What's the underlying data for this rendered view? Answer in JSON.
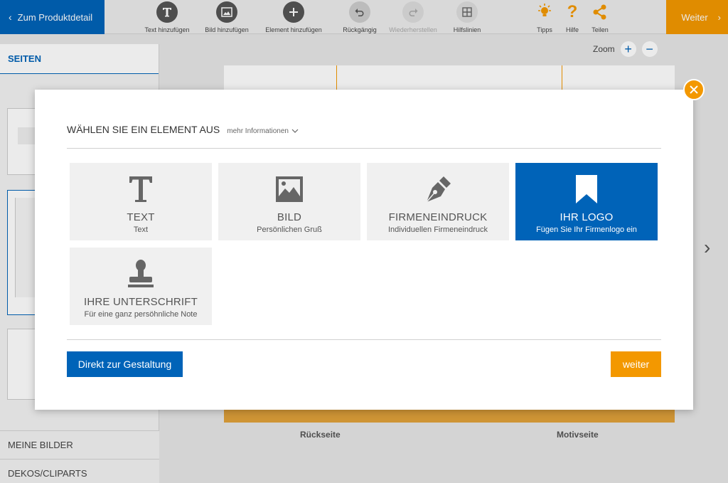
{
  "toolbar": {
    "back_label": "Zum Produktdetail",
    "tools": [
      {
        "label": "Text hinzufügen",
        "icon": "text-icon"
      },
      {
        "label": "Bild hinzufügen",
        "icon": "image-icon"
      },
      {
        "label": "Element hinzufügen",
        "icon": "plus-icon"
      },
      {
        "label": "Rückgängig",
        "icon": "undo-icon"
      },
      {
        "label": "Wiederherstellen",
        "icon": "redo-icon"
      },
      {
        "label": "Hilfslinien",
        "icon": "grid-icon"
      }
    ],
    "right_tools": [
      {
        "label": "Tipps",
        "icon": "lightbulb-icon"
      },
      {
        "label": "Hilfe",
        "icon": "help-icon"
      },
      {
        "label": "Teilen",
        "icon": "share-icon"
      }
    ],
    "next_label": "Weiter"
  },
  "sidebar": {
    "pages_tab": "SEITEN",
    "sections": [
      "MEINE BILDER",
      "DEKOS/CLIPARTS"
    ]
  },
  "canvas": {
    "zoom_label": "Zoom",
    "page_labels": [
      "Rückseite",
      "Motivseite"
    ]
  },
  "modal": {
    "title": "WÄHLEN SIE EIN ELEMENT AUS",
    "more_info": "mehr Informationen",
    "tiles": [
      {
        "title": "TEXT",
        "subtitle": "Text",
        "icon": "text-icon"
      },
      {
        "title": "BILD",
        "subtitle": "Persönlichen Gruß",
        "icon": "image-icon"
      },
      {
        "title": "FIRMENEINDRUCK",
        "subtitle": "Individuellen Firmeneindruck",
        "icon": "pen-nib-icon"
      },
      {
        "title": "IHR LOGO",
        "subtitle": "Fügen Sie Ihr Firmenlogo ein",
        "icon": "bookmark-icon"
      },
      {
        "title": "IHRE UNTERSCHRIFT",
        "subtitle": "Für eine ganz persöhnliche Note",
        "icon": "stamp-icon"
      }
    ],
    "direct_button": "Direkt zur Gestaltung",
    "next_button": "weiter"
  },
  "colors": {
    "primary": "#0063b8",
    "accent": "#f39800"
  }
}
